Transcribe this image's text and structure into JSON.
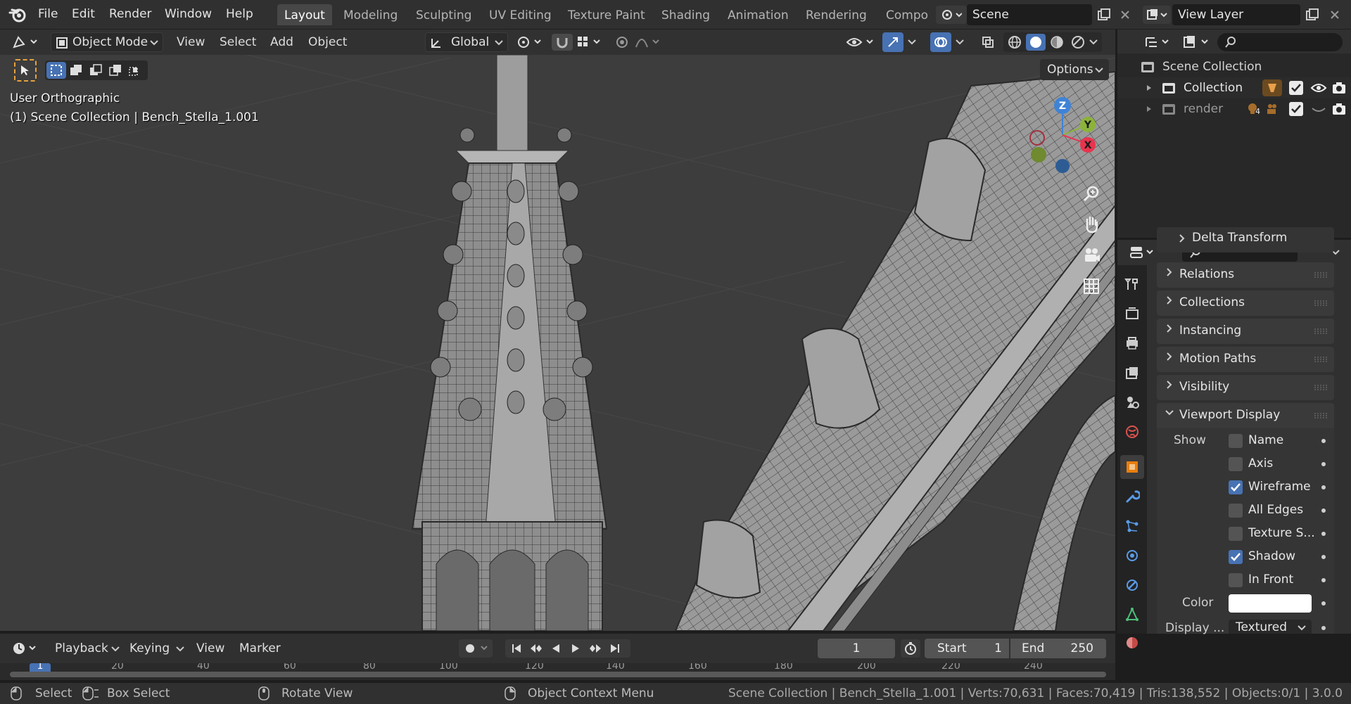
{
  "topbar": {
    "menus": [
      "File",
      "Edit",
      "Render",
      "Window",
      "Help"
    ],
    "workspaces": [
      "Layout",
      "Modeling",
      "Sculpting",
      "UV Editing",
      "Texture Paint",
      "Shading",
      "Animation",
      "Rendering",
      "Compo"
    ],
    "active_workspace": "Layout",
    "scene_name": "Scene",
    "view_layer": "View Layer"
  },
  "viewport": {
    "mode": "Object Mode",
    "menus": [
      "View",
      "Select",
      "Add",
      "Object"
    ],
    "transform_orientation": "Global",
    "options_label": "Options",
    "view_name": "User Orthographic",
    "context": "(1) Scene Collection | Bench_Stella_1.001",
    "gizmo": {
      "z": "Z",
      "y": "Y",
      "x": "X"
    }
  },
  "outliner": {
    "rows": [
      {
        "label": "Scene Collection"
      },
      {
        "label": "Collection",
        "badge": ""
      },
      {
        "label": "render",
        "badge": "4"
      }
    ]
  },
  "properties": {
    "panels": [
      {
        "label": "Delta Transform",
        "expanded": false
      },
      {
        "label": "Relations",
        "expanded": false
      },
      {
        "label": "Collections",
        "expanded": false
      },
      {
        "label": "Instancing",
        "expanded": false
      },
      {
        "label": "Motion Paths",
        "expanded": false
      },
      {
        "label": "Visibility",
        "expanded": false
      },
      {
        "label": "Viewport Display",
        "expanded": true
      }
    ],
    "show_label": "Show",
    "show_options": [
      {
        "label": "Name",
        "checked": false
      },
      {
        "label": "Axis",
        "checked": false
      },
      {
        "label": "Wireframe",
        "checked": true
      },
      {
        "label": "All Edges",
        "checked": false
      },
      {
        "label": "Texture S...",
        "checked": false
      },
      {
        "label": "Shadow",
        "checked": true
      },
      {
        "label": "In Front",
        "checked": false
      }
    ],
    "color_label": "Color",
    "color_value": "#ffffff",
    "display_as_label": "Display ...",
    "display_as_value": "Textured"
  },
  "timeline": {
    "menus": [
      "Playback",
      "Keying",
      "View",
      "Marker"
    ],
    "current_frame": "1",
    "start_label": "Start",
    "start_value": "1",
    "end_label": "End",
    "end_value": "250",
    "ruler": [
      "1",
      "20",
      "40",
      "60",
      "80",
      "100",
      "120",
      "140",
      "160",
      "180",
      "200",
      "220",
      "240"
    ]
  },
  "statusbar": {
    "select": "Select",
    "box_select": "Box Select",
    "rotate_view": "Rotate View",
    "context_menu": "Object Context Menu",
    "stats": "Scene Collection | Bench_Stella_1.001 | Verts:70,631 | Faces:70,419 | Tris:138,552 | Objects:0/1 | 3.0.0"
  },
  "colors": {
    "accent_blue": "#4772b3",
    "axis_x": "#e8344e",
    "axis_y": "#8bb33a",
    "axis_z": "#3f83d6",
    "object_orange": "#e87d0d"
  }
}
